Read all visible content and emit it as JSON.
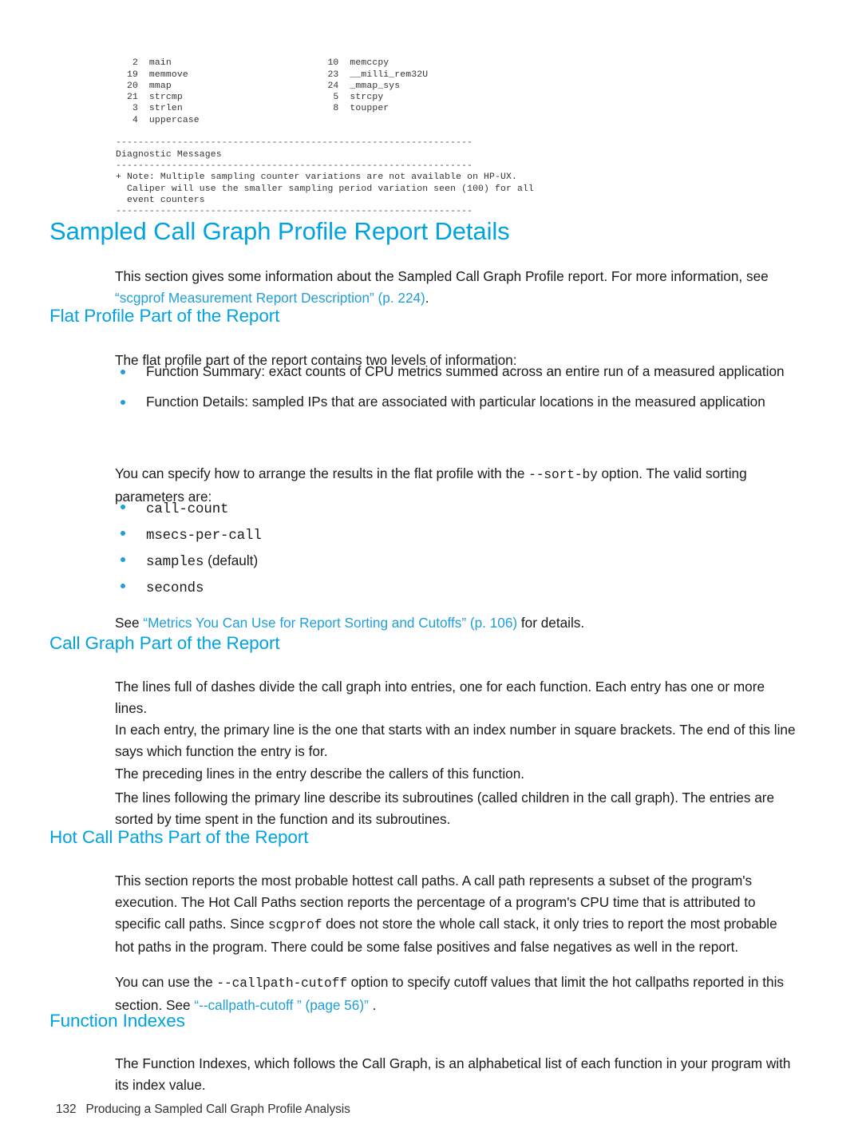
{
  "code_listing": {
    "index_columns": [
      {
        "index": "2",
        "name": "main",
        "index2": "10",
        "name2": "memccpy"
      },
      {
        "index": "19",
        "name": "memmove",
        "index2": "23",
        "name2": "__milli_rem32U"
      },
      {
        "index": "20",
        "name": "mmap",
        "index2": "24",
        "name2": "_mmap_sys"
      },
      {
        "index": "21",
        "name": "strcmp",
        "index2": "5",
        "name2": "strcpy"
      },
      {
        "index": "3",
        "name": "strlen",
        "index2": "8",
        "name2": "toupper"
      },
      {
        "index": "4",
        "name": "uppercase",
        "index2": "",
        "name2": ""
      }
    ],
    "raw": "   2  main                            10  memccpy\n  19  memmove                         23  __milli_rem32U\n  20  mmap                            24  _mmap_sys\n  21  strcmp                           5  strcpy\n   3  strlen                           8  toupper\n   4  uppercase",
    "rule": "----------------------------------------------------------------",
    "diagnostic_header": "Diagnostic Messages",
    "diagnostic_body": "+ Note: Multiple sampling counter variations are not available on HP-UX.\n  Caliper will use the smaller sampling period variation seen (100) for all\n  event counters"
  },
  "doc": {
    "title": "Sampled Call Graph Profile Report Details",
    "intro_pre": "This section gives some information about the Sampled Call Graph Profile report. For more information, see ",
    "intro_link": "“scgprof Measurement Report Description” (p. 224)",
    "intro_post": "."
  },
  "flat_profile": {
    "heading": "Flat Profile Part of the Report",
    "lead": "The flat profile part of the report contains two levels of information:",
    "bullets": [
      "Function Summary: exact counts of CPU metrics summed across an entire run of a measured application",
      "Function Details: sampled IPs that are associated with particular locations in the measured application"
    ],
    "sortby_pre": "You can specify how to arrange the results in the flat profile with the ",
    "sortby_code": "--sort-by",
    "sortby_post": " option. The valid sorting parameters are:",
    "params": [
      {
        "code": "call-count",
        "note": ""
      },
      {
        "code": "msecs-per-call",
        "note": ""
      },
      {
        "code": "samples",
        "note": " (default)"
      },
      {
        "code": "seconds",
        "note": ""
      }
    ],
    "see_pre": "See ",
    "see_link": "“Metrics You Can Use for Report Sorting and Cutoffs” (p. 106)",
    "see_post": " for details."
  },
  "call_graph": {
    "heading": "Call Graph Part of the Report",
    "p1": "The lines full of dashes divide the call graph into entries, one for each function. Each entry has one or more lines.",
    "p2": "In each entry, the primary line is the one that starts with an index number in square brackets. The end of this line says which function the entry is for.",
    "p3": "The preceding lines in the entry describe the callers of this function.",
    "p4": "The lines following the primary line describe its subroutines (called children in the call graph). The entries are sorted by time spent in the function and its subroutines."
  },
  "hot_call_paths": {
    "heading": "Hot Call Paths Part of the Report",
    "p1_a": "This section reports the most probable hottest call paths. A call path represents a subset of the program's execution. The Hot Call Paths section reports the percentage of a program's CPU time that is attributed to specific call paths. Since ",
    "p1_code": "scgprof",
    "p1_b": " does not store the whole call stack, it only tries to report the most probable hot paths in the program. There could be some false positives and false negatives as well in the report.",
    "p2_a": "You can use the ",
    "p2_code": "--callpath-cutoff",
    "p2_b": " option to specify cutoff values that limit the hot callpaths reported in this section. See ",
    "p2_link": "“--callpath-cutoff ” (page 56)”",
    "p2_c": " ."
  },
  "function_indexes": {
    "heading": "Function Indexes",
    "p1": "The Function Indexes, which follows the Call Graph, is an alphabetical list of each function in your program with its index value."
  },
  "footer": {
    "page_number": "132",
    "chapter": "Producing a Sampled Call Graph Profile Analysis"
  },
  "colors": {
    "heading_blue": "#00a3e0",
    "link_blue": "#1f9fd8",
    "body_text": "#1a1a1a",
    "code_text": "#333333",
    "background": "#ffffff"
  }
}
